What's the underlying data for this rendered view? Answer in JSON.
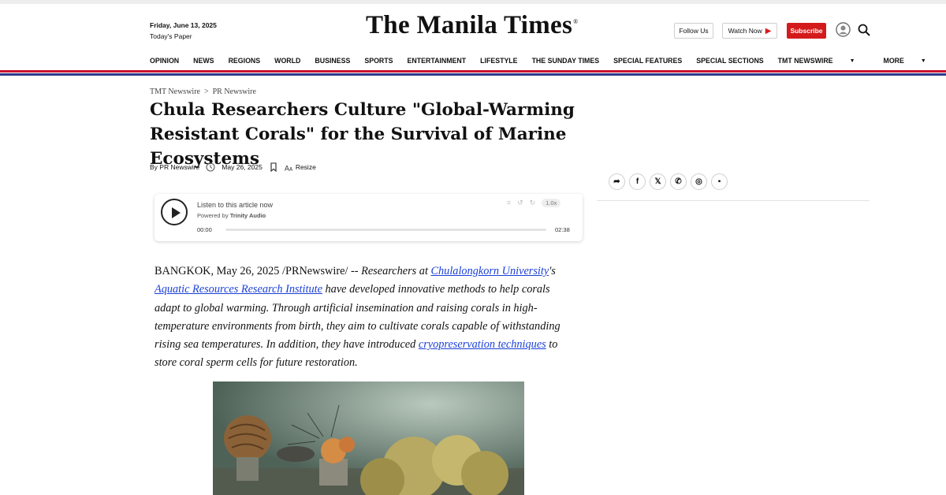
{
  "header": {
    "date": "Friday, June 13, 2025",
    "todays_paper": "Today's Paper",
    "logo": "The Manila Times",
    "logo_mark": "®",
    "follow_label": "Follow Us",
    "watch_label": "Watch Now",
    "subscribe_label": "Subscribe"
  },
  "nav": {
    "items": [
      "OPINION",
      "NEWS",
      "REGIONS",
      "WORLD",
      "BUSINESS",
      "SPORTS",
      "ENTERTAINMENT",
      "LIFESTYLE",
      "THE SUNDAY TIMES",
      "SPECIAL FEATURES",
      "SPECIAL SECTIONS"
    ],
    "dropdown_newswire": "TMT NEWSWIRE",
    "dropdown_more": "MORE"
  },
  "breadcrumb": {
    "first": "TMT Newswire",
    "separator": ">",
    "second": "PR Newswire"
  },
  "article": {
    "title": "Chula Researchers Culture \"Global-Warming Resistant Corals\" for the Survival of Marine Ecosystems",
    "byline": "By PR Newswire",
    "date": "May 26, 2025",
    "resize_label": "Resize",
    "dateline": "BANGKOK, May 26, 2025 /PRNewswire/ -- ",
    "p1": "Researchers at ",
    "link1": "Chulalongkorn University",
    "p2": "'s ",
    "link2": "Aquatic Resources Research Institute",
    "p3": " have developed innovative methods to help corals adapt to global warming. Through artificial insemination and raising corals in high-temperature environments from birth, they aim to cultivate corals capable of withstanding rising sea temperatures. In addition, they have introduced ",
    "link3": "cryopreservation techniques",
    "p4": " to store coral sperm cells for future restoration."
  },
  "audio_player": {
    "listen_label": "Listen to this article now",
    "powered_prefix": "Powered by ",
    "powered_brand": "Trinity Audio",
    "current_time": "00:00",
    "duration": "02:38",
    "speed": "1.0x",
    "progress": 0
  },
  "icons": {
    "user": "user-icon",
    "search": "search-icon",
    "clock": "clock-icon",
    "bookmark": "bookmark-icon",
    "resize": "text-resize-icon",
    "share": "share-icon",
    "facebook": "facebook-icon",
    "x": "x-icon",
    "whatsapp": "whatsapp-icon",
    "instagram": "instagram-icon",
    "comment": "comment-icon"
  },
  "colors": {
    "brand_red": "#d41b1b",
    "rule_blue": "#2b3a8a",
    "link": "#1a3fd6"
  }
}
